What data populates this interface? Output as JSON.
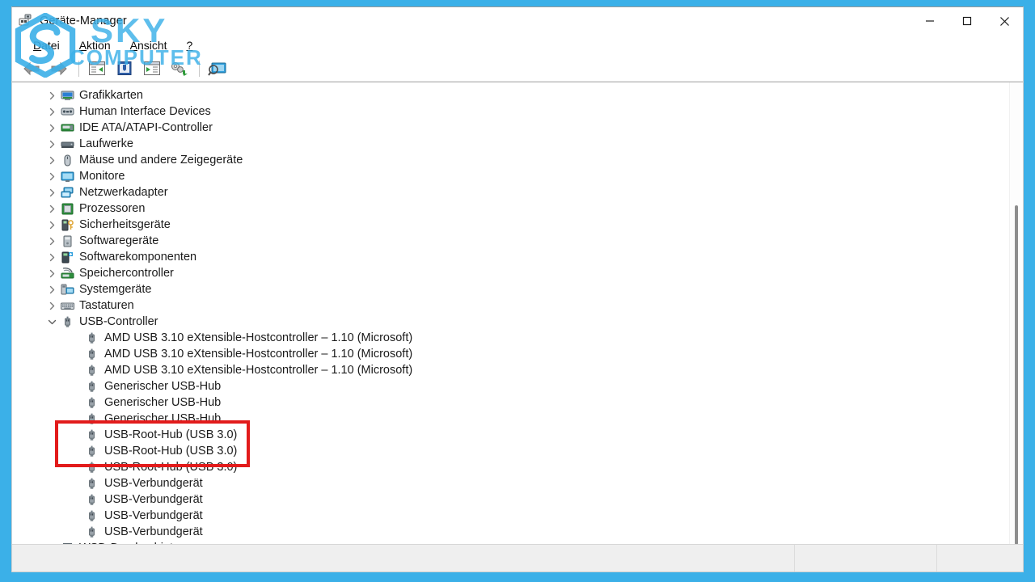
{
  "window": {
    "title": "Geräte-Manager",
    "title_icon": "device-manager-icon",
    "frame_color": "#3bb0e8",
    "caption": {
      "minimize": "—",
      "maximize": "☐",
      "close": "✕",
      "minimize_name": "minimize-button",
      "maximize_name": "maximize-button",
      "close_name": "close-button"
    }
  },
  "menubar": {
    "items": [
      {
        "label": "Datei",
        "accel": "D",
        "rest": "atei"
      },
      {
        "label": "Aktion",
        "accel": "A",
        "rest": "ktion"
      },
      {
        "label": "Ansicht",
        "accel": "A",
        "rest": "nsicht"
      },
      {
        "label": "?",
        "accel": "?",
        "rest": ""
      }
    ]
  },
  "toolbar": {
    "buttons": [
      {
        "name": "back-button",
        "icon": "back-arrow-icon"
      },
      {
        "name": "forward-button",
        "icon": "forward-arrow-icon"
      },
      {
        "name": "toolbar-separator-1",
        "icon": "separator"
      },
      {
        "name": "collapse-all-button",
        "icon": "collapse-all-icon"
      },
      {
        "name": "properties-button",
        "icon": "properties-icon"
      },
      {
        "name": "show-hidden-devices-button",
        "icon": "show-hidden-devices-icon"
      },
      {
        "name": "update-driver-button",
        "icon": "update-driver-icon"
      },
      {
        "name": "toolbar-separator-2",
        "icon": "separator"
      },
      {
        "name": "scan-hardware-changes-button",
        "icon": "scan-hardware-icon"
      }
    ]
  },
  "tree": {
    "items": [
      {
        "level": 1,
        "expander": "collapsed",
        "icon": "display-adapter-icon",
        "label": "Grafikkarten"
      },
      {
        "level": 1,
        "expander": "collapsed",
        "icon": "hid-icon",
        "label": "Human Interface Devices"
      },
      {
        "level": 1,
        "expander": "collapsed",
        "icon": "ide-controller-icon",
        "label": "IDE ATA/ATAPI-Controller"
      },
      {
        "level": 1,
        "expander": "collapsed",
        "icon": "disk-drive-icon",
        "label": "Laufwerke"
      },
      {
        "level": 1,
        "expander": "collapsed",
        "icon": "mouse-icon",
        "label": "Mäuse und andere Zeigegeräte"
      },
      {
        "level": 1,
        "expander": "collapsed",
        "icon": "monitor-icon",
        "label": "Monitore"
      },
      {
        "level": 1,
        "expander": "collapsed",
        "icon": "network-adapter-icon",
        "label": "Netzwerkadapter"
      },
      {
        "level": 1,
        "expander": "collapsed",
        "icon": "processor-icon",
        "label": "Prozessoren"
      },
      {
        "level": 1,
        "expander": "collapsed",
        "icon": "security-device-icon",
        "label": "Sicherheitsgeräte"
      },
      {
        "level": 1,
        "expander": "collapsed",
        "icon": "software-device-icon",
        "label": "Softwaregeräte"
      },
      {
        "level": 1,
        "expander": "collapsed",
        "icon": "software-component-icon",
        "label": "Softwarekomponenten"
      },
      {
        "level": 1,
        "expander": "collapsed",
        "icon": "storage-controller-icon",
        "label": "Speichercontroller"
      },
      {
        "level": 1,
        "expander": "collapsed",
        "icon": "system-device-icon",
        "label": "Systemgeräte"
      },
      {
        "level": 1,
        "expander": "collapsed",
        "icon": "keyboard-icon",
        "label": "Tastaturen"
      },
      {
        "level": 1,
        "expander": "expanded",
        "icon": "usb-icon",
        "label": "USB-Controller"
      },
      {
        "level": 2,
        "expander": "none",
        "icon": "usb-icon",
        "label": "AMD USB 3.10 eXtensible-Hostcontroller – 1.10 (Microsoft)"
      },
      {
        "level": 2,
        "expander": "none",
        "icon": "usb-icon",
        "label": "AMD USB 3.10 eXtensible-Hostcontroller – 1.10 (Microsoft)"
      },
      {
        "level": 2,
        "expander": "none",
        "icon": "usb-icon",
        "label": "AMD USB 3.10 eXtensible-Hostcontroller – 1.10 (Microsoft)"
      },
      {
        "level": 2,
        "expander": "none",
        "icon": "usb-icon",
        "label": "Generischer USB-Hub"
      },
      {
        "level": 2,
        "expander": "none",
        "icon": "usb-icon",
        "label": "Generischer USB-Hub"
      },
      {
        "level": 2,
        "expander": "none",
        "icon": "usb-icon",
        "label": "Generischer USB-Hub"
      },
      {
        "level": 2,
        "expander": "none",
        "icon": "usb-icon",
        "label": "USB-Root-Hub (USB 3.0)"
      },
      {
        "level": 2,
        "expander": "none",
        "icon": "usb-icon",
        "label": "USB-Root-Hub (USB 3.0)"
      },
      {
        "level": 2,
        "expander": "none",
        "icon": "usb-icon",
        "label": "USB-Root-Hub (USB 3.0)"
      },
      {
        "level": 2,
        "expander": "none",
        "icon": "usb-icon",
        "label": "USB-Verbundgerät"
      },
      {
        "level": 2,
        "expander": "none",
        "icon": "usb-icon",
        "label": "USB-Verbundgerät"
      },
      {
        "level": 2,
        "expander": "none",
        "icon": "usb-icon",
        "label": "USB-Verbundgerät"
      },
      {
        "level": 2,
        "expander": "none",
        "icon": "usb-icon",
        "label": "USB-Verbundgerät"
      },
      {
        "level": 1,
        "expander": "collapsed",
        "icon": "printer-icon",
        "label": "WSD-Druckanbieter"
      }
    ]
  },
  "annotation": {
    "highlight_color": "#e21b1b",
    "highlighted_items": [
      "USB-Root-Hub (USB 3.0)",
      "USB-Root-Hub (USB 3.0)",
      "USB-Root-Hub (USB 3.0)"
    ]
  },
  "statusbar": {
    "segments": [
      "",
      "",
      ""
    ]
  },
  "watermark": {
    "line1": "SKY",
    "line2": "COMPUTER",
    "color": "#3bb0e8",
    "logo": "sky-computer-logo"
  }
}
